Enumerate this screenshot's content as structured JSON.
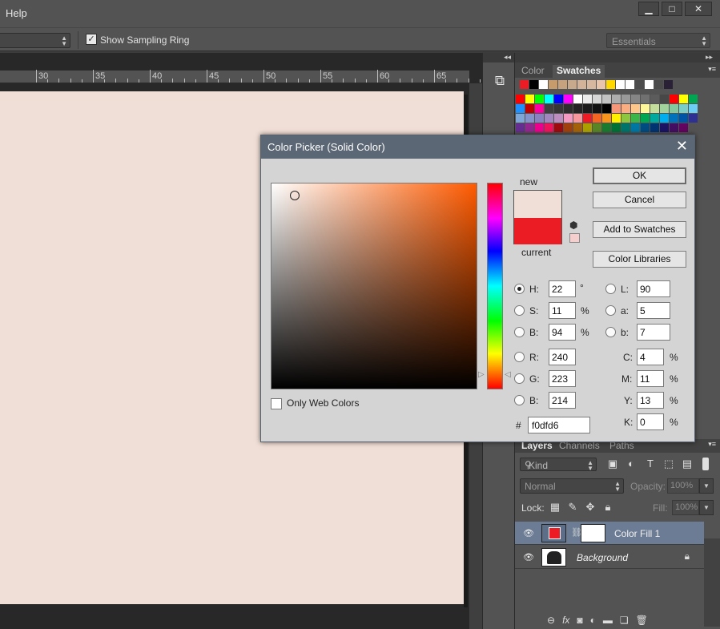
{
  "menu": {
    "help": "Help"
  },
  "window_controls": {
    "minimize": "▁",
    "maximize": "□",
    "close": "✕"
  },
  "options_bar": {
    "sampling_ring_checked": true,
    "sampling_ring_label": "Show Sampling Ring",
    "workspace": "Essentials"
  },
  "ruler": {
    "ticks": [
      "30",
      "35",
      "40",
      "45",
      "50",
      "55",
      "60",
      "65"
    ]
  },
  "document": {
    "canvas_color": "#f0dfd6"
  },
  "swatches_panel": {
    "tabs": [
      "Color",
      "Swatches"
    ],
    "active_tab": "Swatches",
    "recent": [
      "#ed1c24",
      "#000000",
      "#ffffff",
      "#c69c6d",
      "#c7a27e",
      "#c9a98c",
      "#d3b29a",
      "#d7b7a0",
      "#e8c4ad",
      "#ffd800",
      "#ffffff",
      "#ffffff",
      "#4c4c4c",
      "#ffffff",
      "#4c4c4c",
      "#2b2137"
    ],
    "grid": [
      "#ff0000",
      "#ffff00",
      "#00ff00",
      "#00ffff",
      "#0000ff",
      "#ff00ff",
      "#ffffff",
      "#ebebeb",
      "#d6d6d6",
      "#c2c2c2",
      "#adadad",
      "#999999",
      "#858585",
      "#707070",
      "#5c5c5c",
      "#474747",
      "#ff0000",
      "#ffff00",
      "#00a651",
      "#1e90ff",
      "#c00000",
      "#ff00a0",
      "#3f3f3f",
      "#363636",
      "#2d2d2d",
      "#242424",
      "#1b1b1b",
      "#121212",
      "#000000",
      "#f7977a",
      "#f9ad81",
      "#fdc68a",
      "#fff79a",
      "#c4df9b",
      "#a3d39c",
      "#82ca9d",
      "#7bcdc8",
      "#6ecff6",
      "#7ea7d8",
      "#8493ca",
      "#8882be",
      "#a187be",
      "#bc8dbf",
      "#f49ac2",
      "#f6989d",
      "#ed1c24",
      "#f26522",
      "#f7941d",
      "#fff200",
      "#8dc63f",
      "#39b54a",
      "#00a651",
      "#00a99d",
      "#00aeef",
      "#0072bc",
      "#0054a6",
      "#2e3192",
      "#662d91",
      "#92278f",
      "#ec008c",
      "#ed145b",
      "#9e0b0f",
      "#a0410d",
      "#a36209",
      "#aba000",
      "#598527",
      "#1a7b30",
      "#007236",
      "#00746b",
      "#0076a3",
      "#004b80",
      "#003471",
      "#1b1464",
      "#440e62",
      "#630460"
    ]
  },
  "layers_panel": {
    "tabs": [
      "Layers",
      "Channels",
      "Paths"
    ],
    "active_tab": "Layers",
    "filter_kind": "Kind",
    "blend_mode": "Normal",
    "opacity_label": "Opacity:",
    "opacity": "100%",
    "lock_label": "Lock:",
    "fill_label": "Fill:",
    "fill": "100%",
    "layers": [
      {
        "name": "Color Fill 1",
        "selected": true,
        "fill_color": "#ed1c24"
      },
      {
        "name": "Background",
        "selected": false,
        "locked": true
      }
    ],
    "bottom_icons": [
      "link-icon",
      "fx-icon",
      "mask-icon",
      "adjustment-icon",
      "folder-icon",
      "new-layer-icon",
      "trash-icon"
    ]
  },
  "dialog": {
    "title": "Color Picker (Solid Color)",
    "close": "✕",
    "new_label": "new",
    "current_label": "current",
    "new_color": "#f0dfd6",
    "current_color": "#ec1c24",
    "buttons": {
      "ok": "OK",
      "cancel": "Cancel",
      "add_to_swatches": "Add to Swatches",
      "color_libraries": "Color Libraries"
    },
    "selected_mode": "H",
    "fields": {
      "H": {
        "label": "H:",
        "value": "22",
        "unit": "°"
      },
      "S": {
        "label": "S:",
        "value": "11",
        "unit": "%"
      },
      "Bhsb": {
        "label": "B:",
        "value": "94",
        "unit": "%"
      },
      "R": {
        "label": "R:",
        "value": "240"
      },
      "G": {
        "label": "G:",
        "value": "223"
      },
      "Brgb": {
        "label": "B:",
        "value": "214"
      },
      "L": {
        "label": "L:",
        "value": "90"
      },
      "a": {
        "label": "a:",
        "value": "5"
      },
      "b": {
        "label": "b:",
        "value": "7"
      },
      "C": {
        "label": "C:",
        "value": "4",
        "unit": "%"
      },
      "M": {
        "label": "M:",
        "value": "11",
        "unit": "%"
      },
      "Y": {
        "label": "Y:",
        "value": "13",
        "unit": "%"
      },
      "K": {
        "label": "K:",
        "value": "0",
        "unit": "%"
      }
    },
    "hex_label": "#",
    "hex": "f0dfd6",
    "only_web_colors_label": "Only Web Colors",
    "only_web_colors_checked": false
  }
}
